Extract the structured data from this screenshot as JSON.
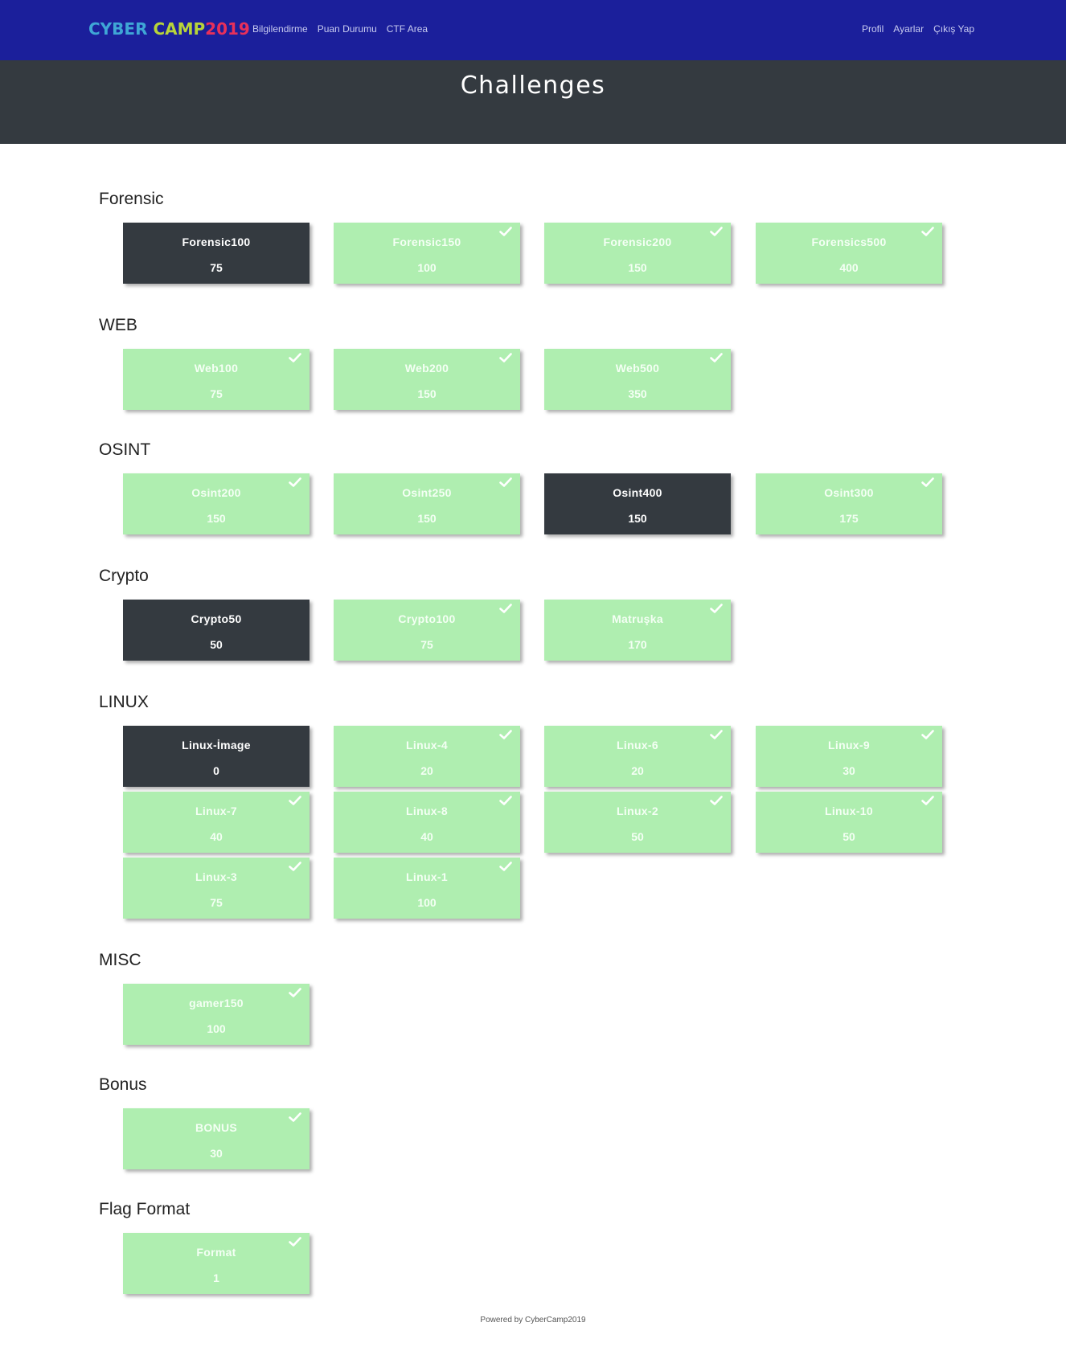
{
  "brand": {
    "part1": "CYBER",
    "part2": "CAMP",
    "part3": "2019"
  },
  "nav": {
    "left": [
      "Bilgilendirme",
      "Puan Durumu",
      "CTF Area"
    ],
    "right": [
      "Profil",
      "Ayarlar",
      "Çıkış Yap"
    ]
  },
  "page_title": "Challenges",
  "categories": [
    {
      "title": "Forensic",
      "challenges": [
        {
          "name": "Forensic100",
          "points": "75",
          "solved": false
        },
        {
          "name": "Forensic150",
          "points": "100",
          "solved": true
        },
        {
          "name": "Forensic200",
          "points": "150",
          "solved": true
        },
        {
          "name": "Forensics500",
          "points": "400",
          "solved": true
        }
      ]
    },
    {
      "title": "WEB",
      "challenges": [
        {
          "name": "Web100",
          "points": "75",
          "solved": true
        },
        {
          "name": "Web200",
          "points": "150",
          "solved": true
        },
        {
          "name": "Web500",
          "points": "350",
          "solved": true
        }
      ]
    },
    {
      "title": "OSINT",
      "challenges": [
        {
          "name": "Osint200",
          "points": "150",
          "solved": true
        },
        {
          "name": "Osint250",
          "points": "150",
          "solved": true
        },
        {
          "name": "Osint400",
          "points": "150",
          "solved": false
        },
        {
          "name": "Osint300",
          "points": "175",
          "solved": true
        }
      ]
    },
    {
      "title": "Crypto",
      "challenges": [
        {
          "name": "Crypto50",
          "points": "50",
          "solved": false
        },
        {
          "name": "Crypto100",
          "points": "75",
          "solved": true
        },
        {
          "name": "Matruşka",
          "points": "170",
          "solved": true
        }
      ]
    },
    {
      "title": "LINUX",
      "challenges": [
        {
          "name": "Linux-İmage",
          "points": "0",
          "solved": false
        },
        {
          "name": "Linux-4",
          "points": "20",
          "solved": true
        },
        {
          "name": "Linux-6",
          "points": "20",
          "solved": true
        },
        {
          "name": "Linux-9",
          "points": "30",
          "solved": true
        },
        {
          "name": "Linux-7",
          "points": "40",
          "solved": true
        },
        {
          "name": "Linux-8",
          "points": "40",
          "solved": true
        },
        {
          "name": "Linux-2",
          "points": "50",
          "solved": true
        },
        {
          "name": "Linux-10",
          "points": "50",
          "solved": true
        },
        {
          "name": "Linux-3",
          "points": "75",
          "solved": true
        },
        {
          "name": "Linux-1",
          "points": "100",
          "solved": true
        }
      ]
    },
    {
      "title": "MISC",
      "challenges": [
        {
          "name": "gamer150",
          "points": "100",
          "solved": true
        }
      ]
    },
    {
      "title": "Bonus",
      "challenges": [
        {
          "name": "BONUS",
          "points": "30",
          "solved": true
        }
      ]
    },
    {
      "title": "Flag Format",
      "challenges": [
        {
          "name": "Format",
          "points": "1",
          "solved": true
        }
      ]
    }
  ],
  "footer": "Powered by CyberCamp2019",
  "colors": {
    "navbar": "#1b1f9b",
    "header": "#343a40",
    "solved": "#afeeb0",
    "unsolved": "#343a40"
  },
  "icons": {
    "solved_marker": "check-icon"
  }
}
